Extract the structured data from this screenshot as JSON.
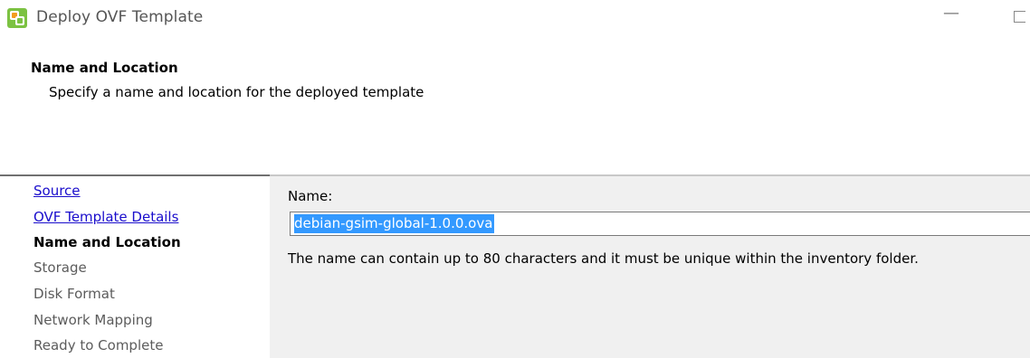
{
  "window": {
    "title": "Deploy OVF Template",
    "minimize_glyph": "—"
  },
  "header": {
    "title": "Name and Location",
    "subtitle": "Specify a name and location for the deployed template"
  },
  "steps": [
    {
      "label": "Source",
      "state": "link"
    },
    {
      "label": "OVF Template Details",
      "state": "link"
    },
    {
      "label": "Name and Location",
      "state": "current"
    },
    {
      "label": "Storage",
      "state": "disabled"
    },
    {
      "label": "Disk Format",
      "state": "disabled"
    },
    {
      "label": "Network Mapping",
      "state": "disabled"
    },
    {
      "label": "Ready to Complete",
      "state": "disabled"
    }
  ],
  "form": {
    "name_label": "Name:",
    "name_value": "debian-gsim-global-1.0.0.ova",
    "help_text": "The name can contain up to 80 characters and it must be unique within the inventory folder."
  },
  "colors": {
    "link": "#1a0dcc",
    "selection": "#3399ff",
    "content_bg": "#f0f0f0",
    "icon_orange": "#f39c1f",
    "icon_green": "#7cc242"
  },
  "icons": {
    "app": "vsphere-logo-icon"
  }
}
